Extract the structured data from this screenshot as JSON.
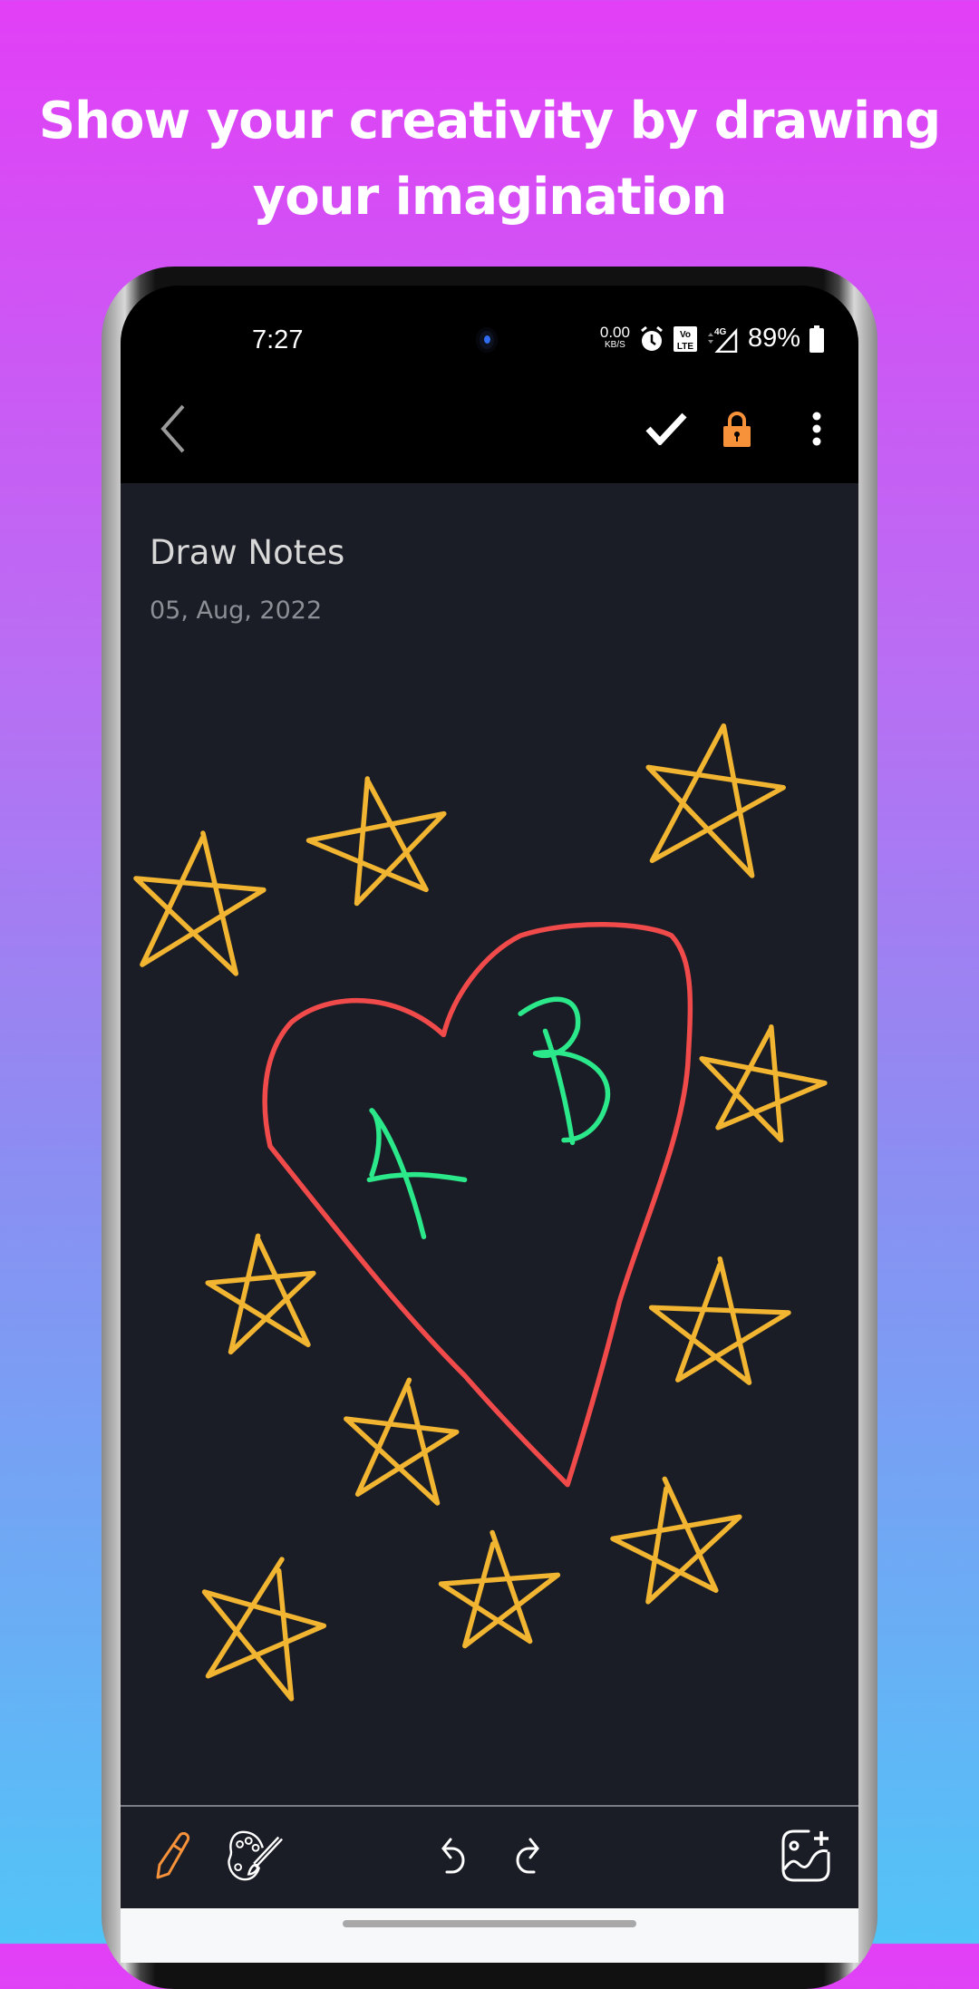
{
  "headline": {
    "line1": "Show your creativity by drawing",
    "line2": "your imagination"
  },
  "status_bar": {
    "time": "7:27",
    "net_speed": "0.00",
    "net_unit": "KB/S",
    "volte": "Vo LTE",
    "network": "4G",
    "battery": "89%"
  },
  "app_bar": {
    "back_icon": "chevron-left-icon",
    "save_icon": "check-icon",
    "lock_icon": "lock-icon",
    "menu_icon": "more-vert-icon",
    "lock_color": "#f7923a"
  },
  "note": {
    "title": "Draw Notes",
    "date": "05, Aug, 2022"
  },
  "drawing": {
    "stroke_colors": {
      "stars": "#f2b531",
      "heart": "#f04a4a",
      "letters": "#2be88a"
    },
    "letters": [
      "A",
      "B"
    ]
  },
  "bottom_toolbar": {
    "tools": [
      "pencil-icon",
      "palette-icon",
      "undo-icon",
      "redo-icon",
      "add-image-icon"
    ],
    "active_tool_color": "#f7923a"
  }
}
